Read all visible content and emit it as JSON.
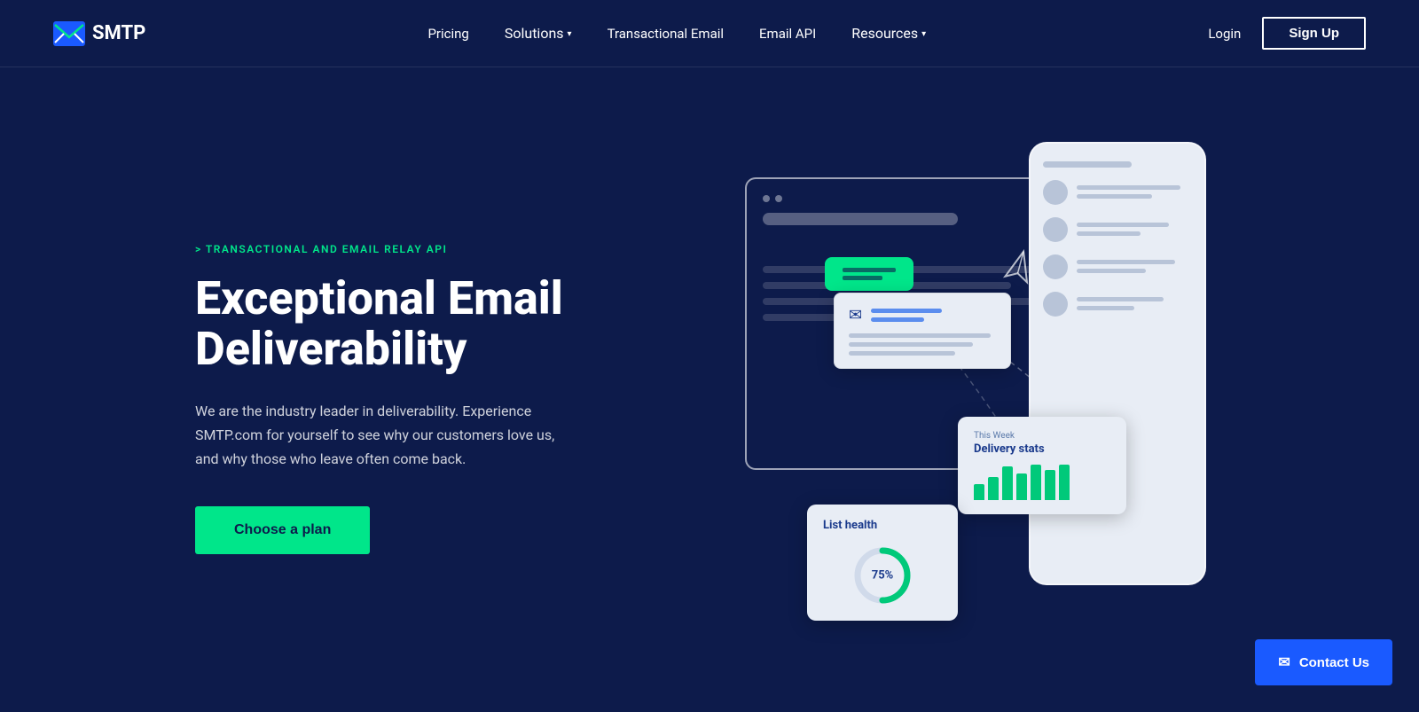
{
  "nav": {
    "logo_text": "SMTP",
    "links": [
      {
        "label": "Pricing",
        "has_dropdown": false
      },
      {
        "label": "Solutions",
        "has_dropdown": true
      },
      {
        "label": "Transactional Email",
        "has_dropdown": false
      },
      {
        "label": "Email API",
        "has_dropdown": false
      },
      {
        "label": "Resources",
        "has_dropdown": true
      }
    ],
    "login_label": "Login",
    "signup_label": "Sign Up"
  },
  "hero": {
    "eyebrow": "> TRANSACTIONAL AND EMAIL RELAY API",
    "title_line1": "Exceptional Email",
    "title_line2": "Deliverability",
    "description": "We are the industry leader in deliverability. Experience SMTP.com for yourself to see why our customers love us, and why those who leave often come back.",
    "cta_label": "Choose a plan"
  },
  "widgets": {
    "delivery_stats": {
      "week_label": "This Week",
      "title": "Delivery stats",
      "bars": [
        20,
        30,
        45,
        35,
        55,
        40,
        60
      ]
    },
    "list_health": {
      "title": "List health",
      "percent": "75%",
      "value": 75
    }
  },
  "contact_us": {
    "label": "Contact Us"
  },
  "colors": {
    "accent_green": "#00e68a",
    "nav_bg": "#0d1b4b",
    "hero_bg": "#0d1b4b",
    "contact_btn": "#1a5aff"
  }
}
